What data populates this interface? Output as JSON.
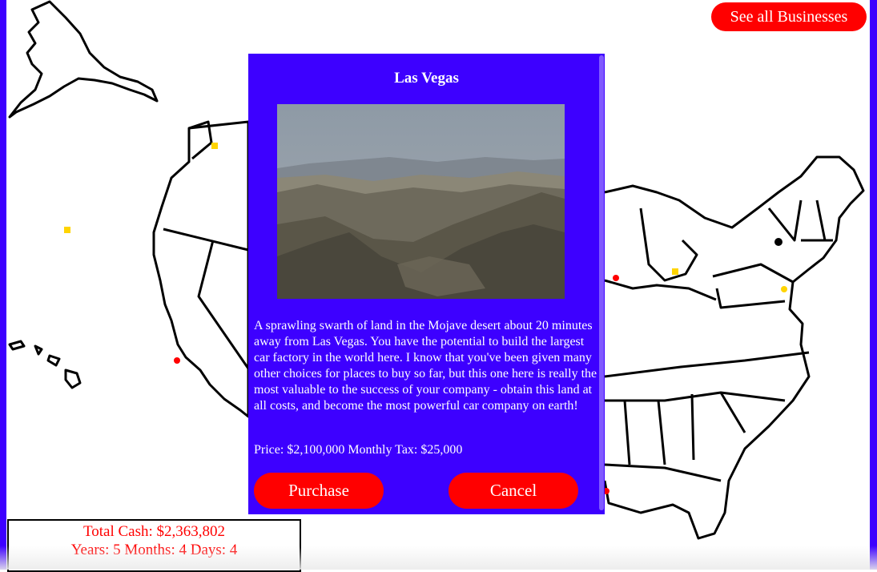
{
  "top_bar": {
    "see_all_label": "See all Businesses"
  },
  "modal": {
    "title": "Las Vegas",
    "description": "A sprawling swarth of land in the Mojave desert about 20 minutes away from Las Vegas. You have the potential to build the largest car factory in the world here. I know that you've been given many other choices for places to buy so far, but this one here is really the most valuable to the success of your company - obtain this land at all costs, and become the most powerful car company on earth!",
    "price_text": "Price: $2,100,000",
    "tax_text": "Monthly Tax: $25,000",
    "purchase_label": "Purchase",
    "cancel_label": "Cancel"
  },
  "stats": {
    "cash_text": "Total Cash: $2,363,802",
    "time_text": "Years: 5 Months: 4 Days: 4"
  },
  "map": {
    "markers": [
      {
        "name": "marker-washington",
        "color": "yellow"
      },
      {
        "name": "marker-pacific",
        "color": "yellow"
      },
      {
        "name": "marker-los-angeles",
        "color": "red"
      },
      {
        "name": "marker-chicago",
        "color": "red"
      },
      {
        "name": "marker-detroit",
        "color": "yellow"
      },
      {
        "name": "marker-new-york",
        "color": "black"
      },
      {
        "name": "marker-new-jersey",
        "color": "yellow"
      },
      {
        "name": "marker-florida",
        "color": "red"
      }
    ]
  },
  "colors": {
    "frame": "#3d00ff",
    "modal_bg": "#3d00ff",
    "button": "#ff0000",
    "stats_text": "#ff0000",
    "marker_yellow": "#ffd400",
    "marker_red": "#ff0000"
  }
}
